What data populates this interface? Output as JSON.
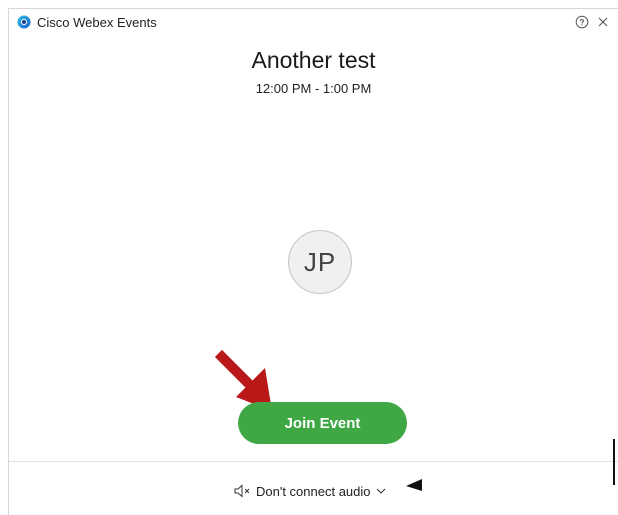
{
  "window": {
    "app_title": "Cisco Webex Events",
    "logo_icon": "webex-logo-icon",
    "help_icon": "help-icon",
    "close_icon": "close-icon"
  },
  "event": {
    "title": "Another test",
    "time": "12:00 PM - 1:00 PM"
  },
  "avatar": {
    "initials": "JP"
  },
  "join": {
    "label": "Join Event",
    "color": "#3fa845"
  },
  "audio": {
    "label": "Don't connect audio",
    "icon": "speaker-muted-icon",
    "dropdown_icon": "chevron-down-icon"
  },
  "annotations": {
    "red_arrow_color": "#b81818",
    "black_arrow_color": "#111111"
  }
}
